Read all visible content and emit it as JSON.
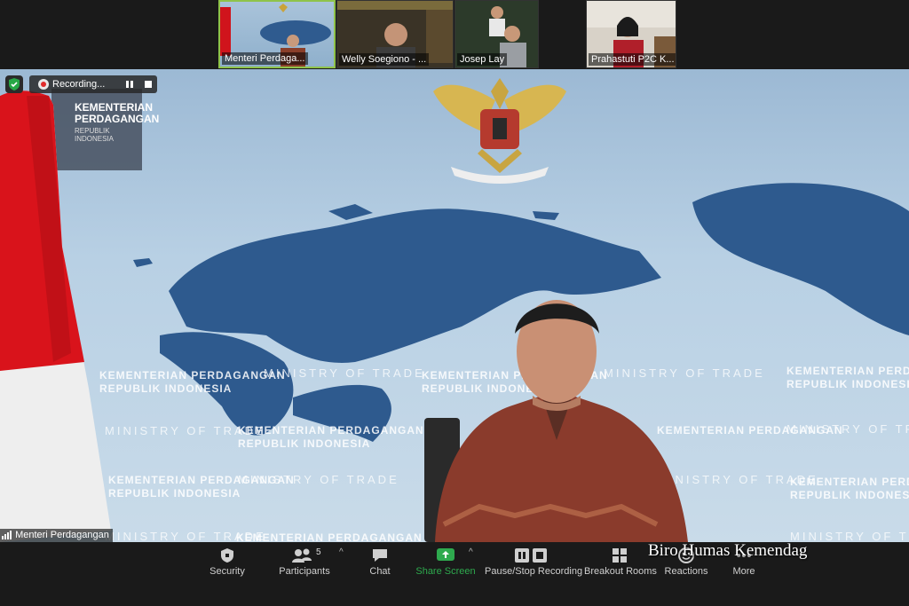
{
  "participants_strip": [
    {
      "name": "Menteri Perdaga...",
      "active": true
    },
    {
      "name": "Welly Soegiono - ...",
      "active": false
    },
    {
      "name": "Josep Lay",
      "active": false
    },
    {
      "name": "Prahastuti P2C K...",
      "active": false
    }
  ],
  "recording": {
    "label": "Recording..."
  },
  "speaker": {
    "name": "Menteri Perdagangan"
  },
  "backdrop": {
    "org_name_line1": "KEMENTERIAN",
    "org_name_line2": "PERDAGANGAN",
    "org_name_line3": "REPUBLIK INDONESIA",
    "ministry": "MINISTRY OF TRADE",
    "kementerian": "KEMENTERIAN PERDAGANGAN",
    "republik": "REPUBLIK INDONESIA"
  },
  "toolbar": {
    "security": "Security",
    "participants": "Participants",
    "participants_count": "5",
    "chat": "Chat",
    "share_screen": "Share Screen",
    "pause_stop_recording": "Pause/Stop Recording",
    "breakout_rooms": "Breakout Rooms",
    "reactions": "Reactions",
    "more": "More"
  },
  "watermark": "Biro Humas Kemendag",
  "colors": {
    "accent_green": "#8fc34a",
    "share_green": "#2eaa4e",
    "toolbar_bg": "#1a1a1a"
  }
}
